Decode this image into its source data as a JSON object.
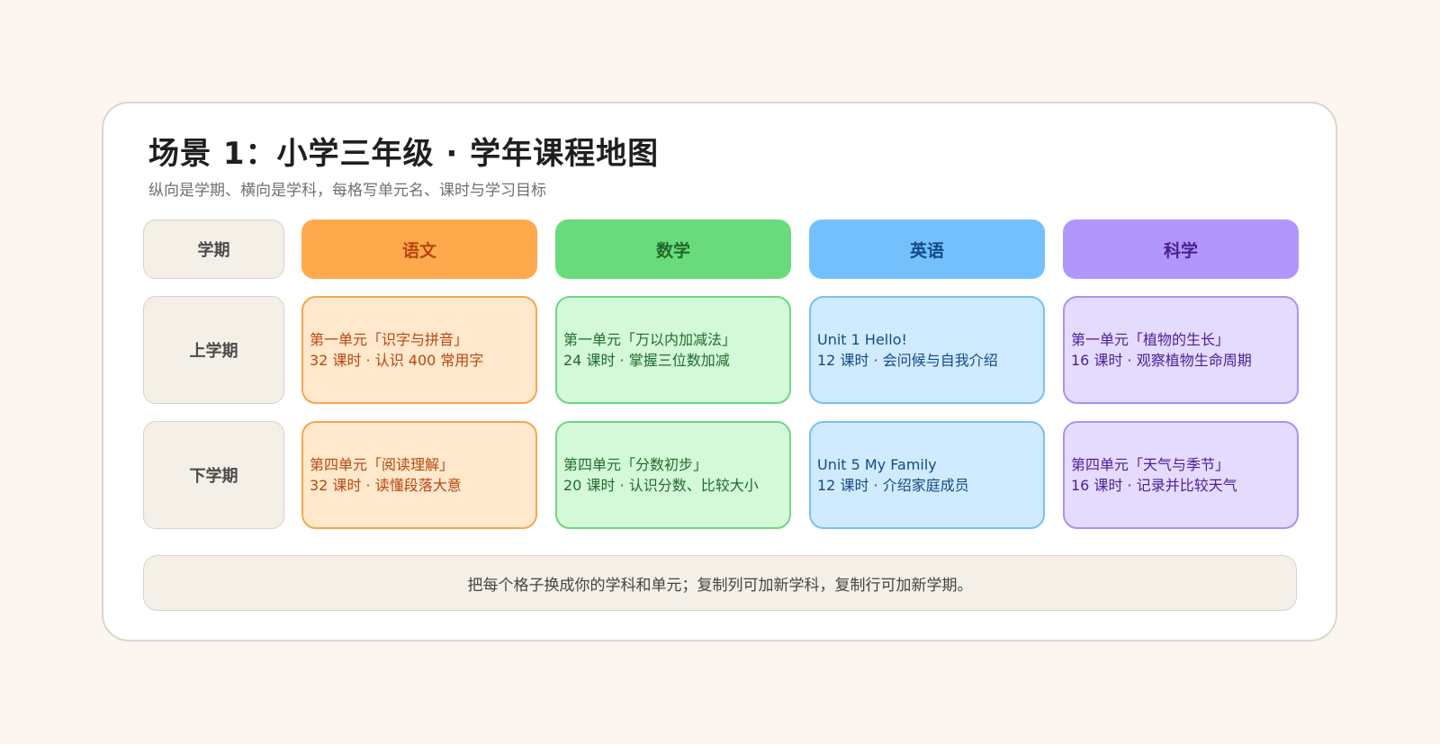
{
  "title": "场景 1：小学三年级 · 学年课程地图",
  "subtitle": "纵向是学期、横向是学科，每格写单元名、课时与学习目标",
  "corner_label": "学期",
  "subjects": [
    {
      "label": "语文",
      "head_bg": "#ffa94d",
      "head_fg": "#b94410",
      "cell_bg": "#ffe8cc",
      "cell_border": "#f7a651",
      "cell_fg": "#b9460f"
    },
    {
      "label": "数学",
      "head_bg": "#69db7c",
      "head_fg": "#1f6b2c",
      "cell_bg": "#d3f9d8",
      "cell_border": "#6fd683",
      "cell_fg": "#216b2e"
    },
    {
      "label": "英语",
      "head_bg": "#74c0fc",
      "head_fg": "#134a86",
      "cell_bg": "#d0ebff",
      "cell_border": "#79bff5",
      "cell_fg": "#134a86"
    },
    {
      "label": "科学",
      "head_bg": "#b197fc",
      "head_fg": "#4c1f96",
      "cell_bg": "#e5dbff",
      "cell_border": "#ab92f2",
      "cell_fg": "#4c1f96"
    }
  ],
  "terms": [
    {
      "label": "上学期",
      "cells": [
        {
          "unit": "第一单元「识字与拼音」",
          "detail": "32 课时 · 认识 400 常用字"
        },
        {
          "unit": "第一单元「万以内加减法」",
          "detail": "24 课时 · 掌握三位数加减"
        },
        {
          "unit": "Unit 1 Hello!",
          "detail": "12 课时 · 会问候与自我介绍"
        },
        {
          "unit": "第一单元「植物的生长」",
          "detail": "16 课时 · 观察植物生命周期"
        }
      ]
    },
    {
      "label": "下学期",
      "cells": [
        {
          "unit": "第四单元「阅读理解」",
          "detail": "32 课时 · 读懂段落大意"
        },
        {
          "unit": "第四单元「分数初步」",
          "detail": "20 课时 · 认识分数、比较大小"
        },
        {
          "unit": "Unit 5 My Family",
          "detail": "12 课时 · 介绍家庭成员"
        },
        {
          "unit": "第四单元「天气与季节」",
          "detail": "16 课时 · 记录并比较天气"
        }
      ]
    }
  ],
  "footer": "把每个格子换成你的学科和单元；复制列可加新学科，复制行可加新学期。"
}
